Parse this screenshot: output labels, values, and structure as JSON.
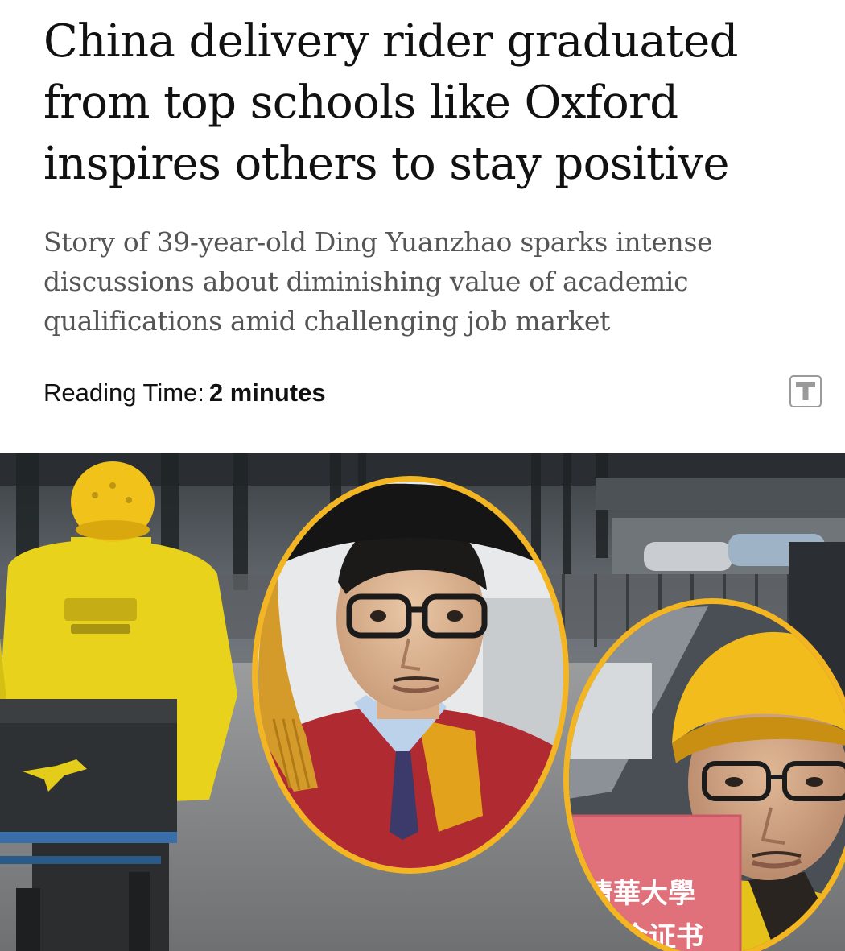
{
  "article": {
    "headline": "China delivery rider graduated from top schools like Oxford inspires others to stay positive",
    "subheadline": "Story of 39-year-old Ding Yuanzhao sparks intense discussions about diminishing value of academic qualifications amid challenging job market",
    "reading_time_label": "Reading Time:",
    "reading_time_value": "2 minutes"
  },
  "toolbar": {
    "text_size_icon": "text-size-icon"
  },
  "hero_image": {
    "certificate_line1": "清華大學",
    "certificate_line2": "学金证书"
  },
  "colors": {
    "accent_yellow": "#f3b521",
    "gown_red": "#b02a32",
    "subheadline_gray": "#555555"
  }
}
